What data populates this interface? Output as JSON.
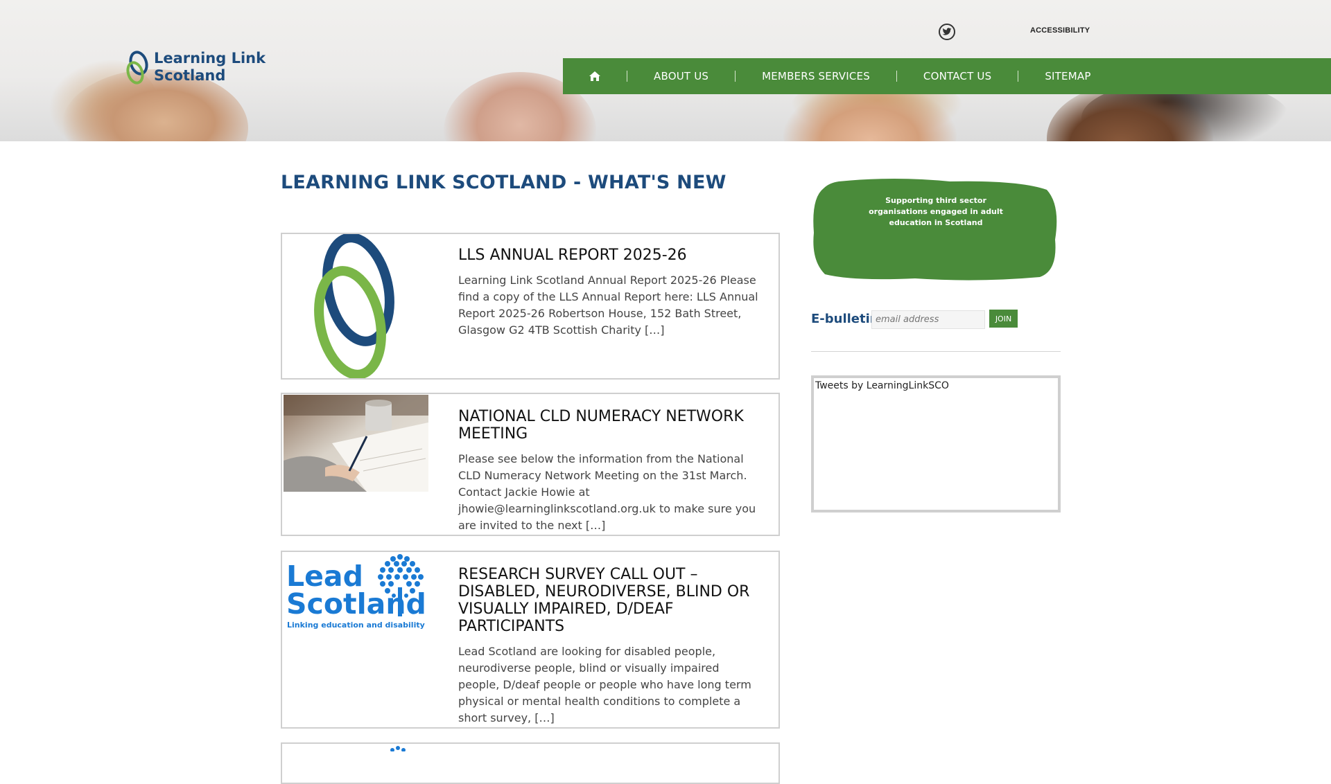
{
  "header": {
    "logo_line1": "Learning Link",
    "logo_line2": "Scotland",
    "twitter_icon": "twitter-icon",
    "accessibility": "ACCESSIBILITY",
    "nav": {
      "home_icon": "home-icon",
      "items": [
        "ABOUT US",
        "MEMBERS SERVICES",
        "CONTACT US",
        "SITEMAP"
      ]
    }
  },
  "main": {
    "title": "LEARNING LINK SCOTLAND - WHAT'S NEW",
    "posts": [
      {
        "title": "LLS ANNUAL REPORT 2025-26",
        "excerpt": "Learning Link Scotland Annual Report 2025-26 Please find a copy of the LLS Annual Report here: LLS Annual Report 2025-26 Robertson House, 152 Bath Street, Glasgow G2 4TB Scottish Charity […]"
      },
      {
        "title": "NATIONAL CLD NUMERACY NETWORK MEETING",
        "excerpt": "Please see below the information from the National CLD Numeracy Network Meeting on the 31st March. Contact Jackie Howie at jhowie@learninglinkscotland.org.uk to make sure you are invited to the next […]"
      },
      {
        "title": "RESEARCH SURVEY CALL OUT – DISABLED, NEURODIVERSE, BLIND OR VISUALLY IMPAIRED, D/DEAF PARTICIPANTS",
        "excerpt": "Lead Scotland are looking for disabled people, neurodiverse people, blind or visually impaired people, D/deaf people or people who have long term physical or mental health conditions to complete a short survey, […]",
        "thumb_line1": "Lead",
        "thumb_line2": "Scotland",
        "thumb_tagline": "Linking education and disability"
      }
    ]
  },
  "sidebar": {
    "tagline": "Supporting third sector organisations engaged in adult education in Scotland",
    "ebulletin_label": "E-bulletin",
    "ebulletin_placeholder": "email address",
    "join_label": "JOIN",
    "tweets_label": "Tweets by LearningLinkSCO"
  },
  "colors": {
    "brand_blue": "#1d4b7c",
    "brand_green": "#4a8b3a",
    "light_green": "#7ab648",
    "lead_blue": "#1a7ad4"
  }
}
